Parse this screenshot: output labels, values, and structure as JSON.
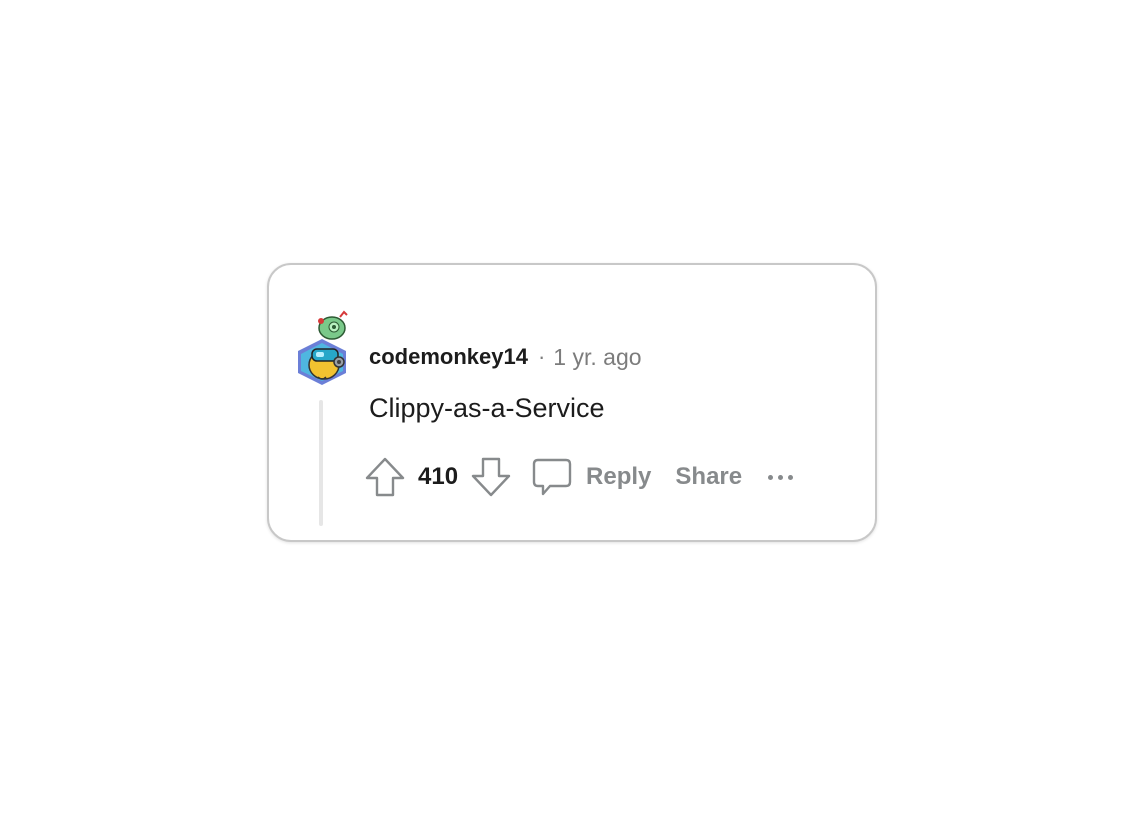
{
  "comment": {
    "username": "codemonkey14",
    "separator": "·",
    "timestamp": "1 yr. ago",
    "body": "Clippy-as-a-Service",
    "score": "410"
  },
  "actions": {
    "reply_label": "Reply",
    "share_label": "Share"
  },
  "icons": {
    "upvote": "arrow-up-outline-icon",
    "downvote": "arrow-down-outline-icon",
    "reply": "speech-bubble-icon",
    "more": "horizontal-ellipsis-icon"
  },
  "colors": {
    "text_primary": "#1c1c1c",
    "text_muted": "#7c7c7c",
    "action_gray": "#878a8c",
    "border": "#c8c8c8",
    "thread_line": "#e6e6e6"
  }
}
